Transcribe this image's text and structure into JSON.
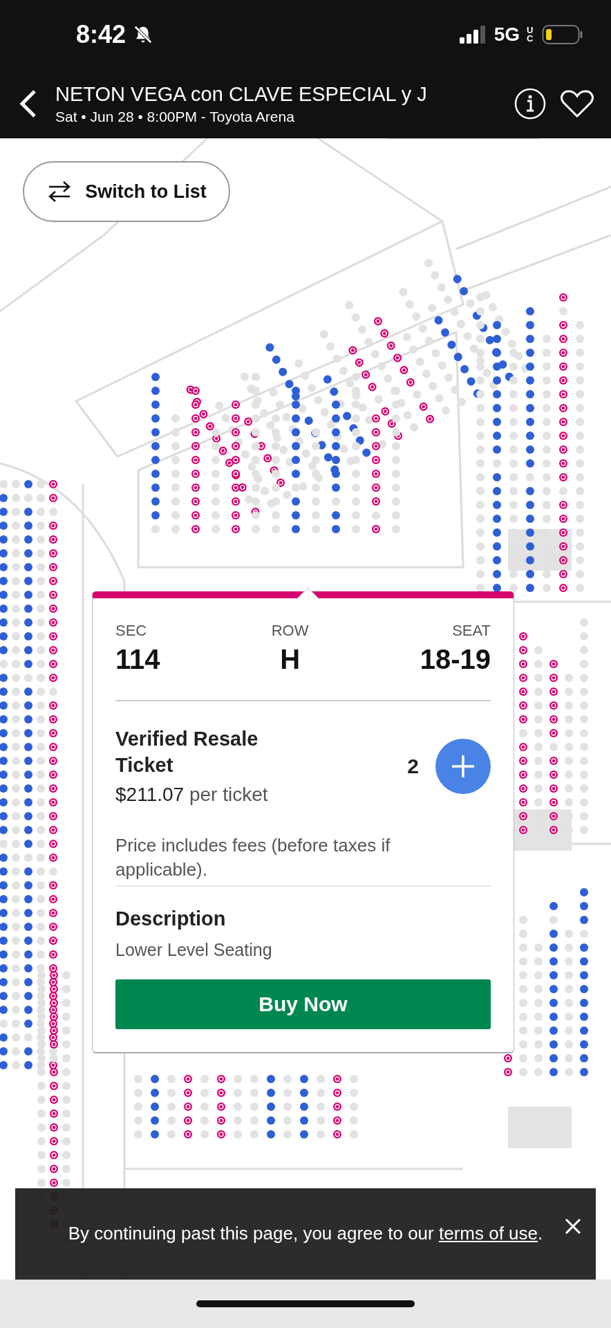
{
  "status_bar": {
    "time": "8:42",
    "network": "5G",
    "network_badge": "UC"
  },
  "header": {
    "title": "NETON VEGA con CLAVE ESPECIAL y J",
    "subtitle": "Sat • Jun 28 • 8:00PM - Toyota Arena"
  },
  "map": {
    "switch_button": "Switch to List"
  },
  "ticket": {
    "fields": [
      {
        "label": "SEC",
        "value": "114"
      },
      {
        "label": "ROW",
        "value": "H"
      },
      {
        "label": "SEAT",
        "value": "18-19"
      }
    ],
    "type": "Verified Resale Ticket",
    "price": "$211.07",
    "price_unit": "per ticket",
    "quantity": "2",
    "fee_note": "Price includes fees (before taxes if applicable).",
    "description_heading": "Description",
    "description": "Lower Level Seating",
    "buy_button": "Buy Now"
  },
  "banner": {
    "text": "By continuing past this page, you agree to our",
    "link": "terms of use",
    "after": "."
  }
}
